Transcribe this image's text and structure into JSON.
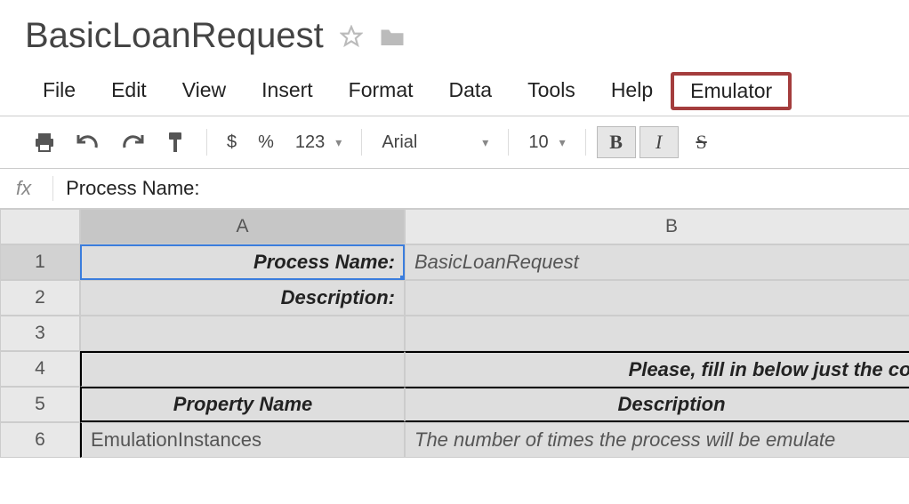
{
  "header": {
    "doc_title": "BasicLoanRequest"
  },
  "menubar": {
    "items": [
      "File",
      "Edit",
      "View",
      "Insert",
      "Format",
      "Data",
      "Tools",
      "Help",
      "Emulator"
    ],
    "highlighted_index": 8
  },
  "toolbar": {
    "currency": "$",
    "percent": "%",
    "number_format": "123",
    "font_name": "Arial",
    "font_size": "10",
    "bold": "B",
    "italic": "I",
    "strike": "S"
  },
  "formula_bar": {
    "fx_label": "fx",
    "value": "Process Name:"
  },
  "columns": [
    "A",
    "B"
  ],
  "rows": [
    {
      "num": "1",
      "a": {
        "text": "Process Name:",
        "style": "bold-italic right selected"
      },
      "b": {
        "text": "BasicLoanRequest",
        "style": "italic"
      }
    },
    {
      "num": "2",
      "a": {
        "text": "Description:",
        "style": "bold-italic right"
      },
      "b": {
        "text": "",
        "style": ""
      }
    },
    {
      "num": "3",
      "a": {
        "text": "",
        "style": ""
      },
      "b": {
        "text": "",
        "style": ""
      }
    },
    {
      "num": "4",
      "a": {
        "text": "",
        "style": "thick-top thick-left"
      },
      "b": {
        "text": "Please, fill in below just the colu",
        "style": "bold-italic right thick-top"
      }
    },
    {
      "num": "5",
      "a": {
        "text": "Property Name",
        "style": "bold-italic center thick-top thick-left thick-bottom"
      },
      "b": {
        "text": "Description",
        "style": "bold-italic center thick-top thick-bottom"
      }
    },
    {
      "num": "6",
      "a": {
        "text": "EmulationInstances",
        "style": "plain thick-left"
      },
      "b": {
        "text": "The number of times the process will be emulate",
        "style": "italic"
      }
    }
  ]
}
